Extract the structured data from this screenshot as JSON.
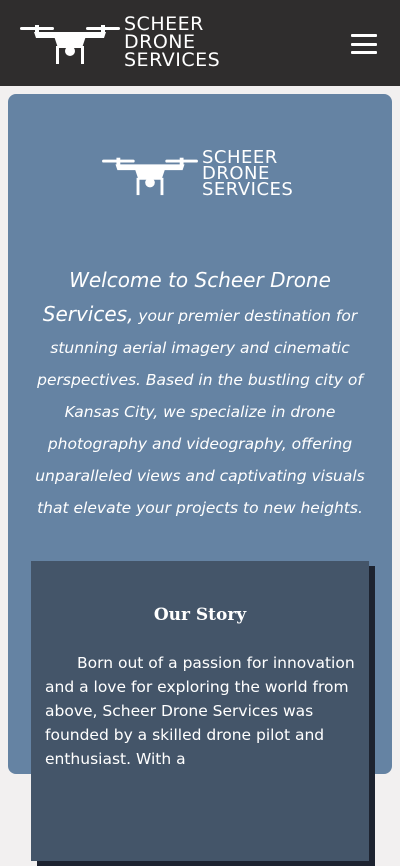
{
  "header": {
    "logo_lines": [
      "SCHEER",
      "DRONE",
      "SERVICES"
    ],
    "logo_icon": "drone-icon",
    "menu_icon": "hamburger-icon"
  },
  "hero": {
    "logo_lines": [
      "SCHEER",
      "DRONE",
      "SERVICES"
    ],
    "logo_icon": "drone-icon"
  },
  "intro": {
    "lead": "Welcome to Scheer Drone Services,",
    "body": " your premier destination for stunning aerial imagery and cinematic perspectives. Based in the bustling city of Kansas City, we specialize in drone photography and videography, offering unparalleled views and captivating visuals that elevate your projects to new heights."
  },
  "story": {
    "title": "Our Story",
    "body": "Born out of a passion for innovation and a love for exploring the world from above, Scheer Drone Services was founded by a skilled drone pilot and enthusiast. With a"
  },
  "colors": {
    "topbar": "#2f2d2d",
    "page_bg": "#f2f0f0",
    "panel": "#6583a3",
    "story_card": "#445569",
    "text": "#ffffff"
  }
}
